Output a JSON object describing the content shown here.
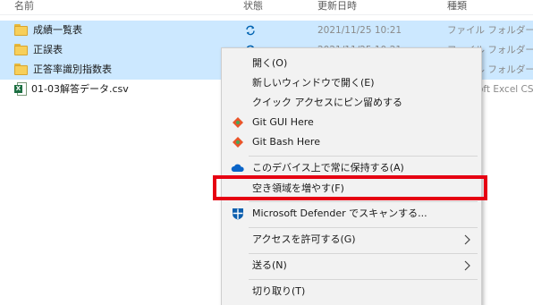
{
  "columns": {
    "name": "名前",
    "status": "状態",
    "date": "更新日時",
    "type": "種類"
  },
  "files": [
    {
      "name": "成績一覧表",
      "date": "2021/11/25 10:21",
      "type": "ファイル フォルダー",
      "icon": "folder-icon",
      "selected": true,
      "sync": true
    },
    {
      "name": "正誤表",
      "date": "2021/11/25 10:21",
      "type": "ファイル フォルダー",
      "icon": "folder-icon",
      "selected": true,
      "sync": true
    },
    {
      "name": "正答率識別指数表",
      "date": "",
      "type": "ファイル フォルダー",
      "icon": "folder-icon",
      "selected": true,
      "sync": false
    },
    {
      "name": "01-03解答データ.csv",
      "date": "",
      "type": "oft Excel CS",
      "icon": "excel-icon",
      "selected": false,
      "sync": false
    }
  ],
  "context_menu": {
    "open": "開く(O)",
    "open_new_window": "新しいウィンドウで開く(E)",
    "pin_quick_access": "クイック アクセスにピン留めする",
    "git_gui": "Git GUI Here",
    "git_bash": "Git Bash Here",
    "keep_on_device": "このデバイス上で常に保持する(A)",
    "free_up_space": "空き領域を増やす(F)",
    "defender_scan": "Microsoft Defender でスキャンする...",
    "give_access": "アクセスを許可する(G)",
    "send_to": "送る(N)",
    "cut": "切り取り(T)"
  },
  "colors": {
    "selection": "#cce8ff",
    "highlight_border": "#e60012",
    "sync_icon": "#0063b1",
    "onedrive": "#0a64c8",
    "defender": "#0d5fae",
    "git_orange": "#e8562a",
    "git_green": "#4aa55b"
  }
}
